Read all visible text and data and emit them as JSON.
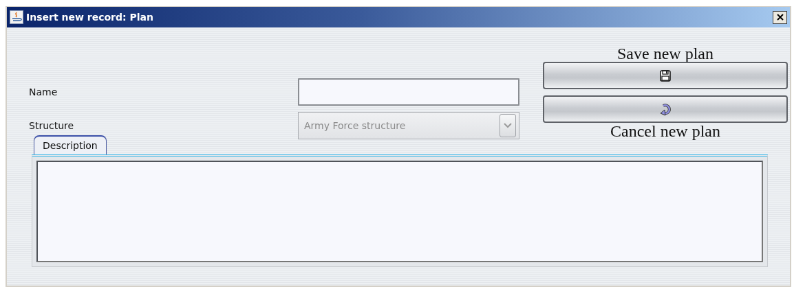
{
  "window": {
    "title": "Insert new record: Plan"
  },
  "fields": [
    {
      "kind": "text",
      "label": "Name",
      "disabled": false
    },
    {
      "kind": "combo",
      "label": "Structure",
      "value": "Army Force structure",
      "disabled": true
    }
  ],
  "buttons": [
    {
      "kind": "save",
      "caption": "Save new plan"
    },
    {
      "kind": "cancel",
      "caption": "Cancel new plan"
    }
  ],
  "tabs": [
    {
      "label": "Description",
      "selected": true
    }
  ]
}
